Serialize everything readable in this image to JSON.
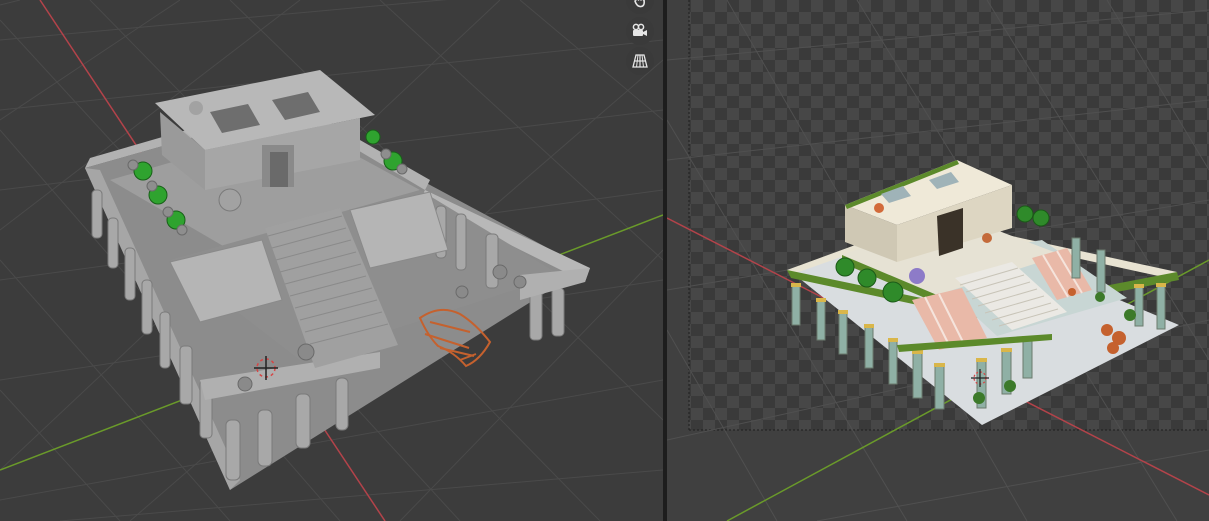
{
  "viewports": {
    "left": {
      "shading": "solid",
      "grid_color": "#4a4a4a",
      "floor": "#3c3c3c",
      "axis_x_color": "#b3434a",
      "axis_y_color": "#6a9a2a"
    },
    "right": {
      "shading": "rendered",
      "checker_a": "#3a3a3a",
      "checker_b": "#474747",
      "axis_x_color": "#b3434a",
      "axis_y_color": "#6a9a2a"
    }
  },
  "navigation_gizmo": {
    "buttons": [
      {
        "icon": "hand-pan-icon"
      },
      {
        "icon": "camera-icon"
      },
      {
        "icon": "perspective-grid-icon"
      }
    ]
  },
  "model": {
    "name_visible": false,
    "colors": {
      "clay": "#9a9a9a",
      "clay_dark": "#6e6e6e",
      "foliage": "#2fa32f",
      "coral": "#c5612e",
      "stone": "#e8e3d2",
      "trim": "#5c8a2b",
      "floor_tile": "#d9dde0",
      "awning": "#e9b9a8"
    }
  }
}
